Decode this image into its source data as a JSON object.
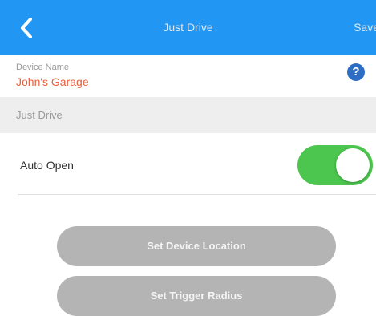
{
  "navbar": {
    "back_icon": "chevron-left-icon",
    "title": "Just Drive",
    "save_label": "Save"
  },
  "device": {
    "label": "Device Name",
    "value": "John's Garage",
    "help_icon": "question-circle-icon",
    "help_glyph": "?"
  },
  "section": {
    "header": "Just Drive"
  },
  "auto_open": {
    "label": "Auto Open",
    "enabled": true
  },
  "buttons": {
    "set_location": "Set Device Location",
    "set_radius": "Set Trigger Radius"
  },
  "colors": {
    "navbar": "#2196f3",
    "device_value": "#e8603c",
    "help_icon": "#2d6ec4",
    "toggle_on": "#4cc64e",
    "button_bg": "#b4b4b4",
    "section_bg": "#eeeeee"
  }
}
